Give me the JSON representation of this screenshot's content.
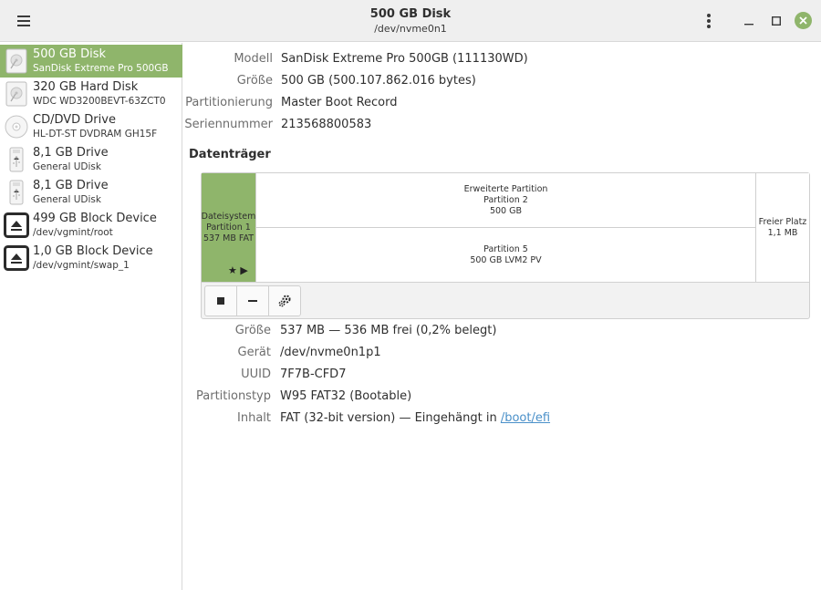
{
  "header": {
    "title": "500 GB Disk",
    "subtitle": "/dev/nvme0n1",
    "menu_icon": "hamburger-menu-icon",
    "kebab_icon": "vertical-dots-icon",
    "close_color": "#8fb56b"
  },
  "sidebar": {
    "accent": "#8fb56b",
    "items": [
      {
        "name": "500 GB Disk",
        "desc": "SanDisk Extreme Pro 500GB",
        "icon": "hard-disk-icon",
        "selected": true
      },
      {
        "name": "320 GB Hard Disk",
        "desc": "WDC WD3200BEVT-63ZCT0",
        "icon": "hard-disk-icon"
      },
      {
        "name": "CD/DVD Drive",
        "desc": "HL-DT-ST DVDRAM GH15F",
        "icon": "optical-disc-icon"
      },
      {
        "name": "8,1 GB Drive",
        "desc": "General UDisk",
        "icon": "usb-drive-icon"
      },
      {
        "name": "8,1 GB Drive",
        "desc": "General UDisk",
        "icon": "usb-drive-icon"
      },
      {
        "name": "499 GB Block Device",
        "desc": "/dev/vgmint/root",
        "icon": "eject-icon"
      },
      {
        "name": "1,0 GB Block Device",
        "desc": "/dev/vgmint/swap_1",
        "icon": "eject-icon"
      }
    ]
  },
  "disk": {
    "model_label": "Modell",
    "model": "SanDisk Extreme Pro 500GB (111130WD)",
    "size_label": "Größe",
    "size": "500 GB (500.107.862.016 bytes)",
    "partitioning_label": "Partitionierung",
    "partitioning": "Master Boot Record",
    "serial_label": "Seriennummer",
    "serial": "213568800583"
  },
  "volumes": {
    "title": "Datenträger",
    "p1": {
      "line1": "Dateisystem",
      "line2": "Partition 1",
      "line3": "537 MB FAT"
    },
    "extended": {
      "line1": "Erweiterte Partition",
      "line2": "Partition 2",
      "line3": "500 GB"
    },
    "p5": {
      "line1": "Partition 5",
      "line2": "500 GB LVM2 PV"
    },
    "free": {
      "line1": "Freier Platz",
      "line2": "1,1 MB"
    },
    "flags": "★ ▶",
    "toolbar": {
      "stop_icon": "stop-icon",
      "remove_icon": "minus-icon",
      "settings_icon": "gears-icon"
    }
  },
  "partition": {
    "size_label": "Größe",
    "size": "537 MB — 536 MB frei (0,2% belegt)",
    "device_label": "Gerät",
    "device": "/dev/nvme0n1p1",
    "uuid_label": "UUID",
    "uuid": "7F7B-CFD7",
    "type_label": "Partitionstyp",
    "type": "W95 FAT32 (Bootable)",
    "contents_label": "Inhalt",
    "contents_prefix": "FAT (32-bit version) — Eingehängt in ",
    "contents_link": "/boot/efi"
  }
}
